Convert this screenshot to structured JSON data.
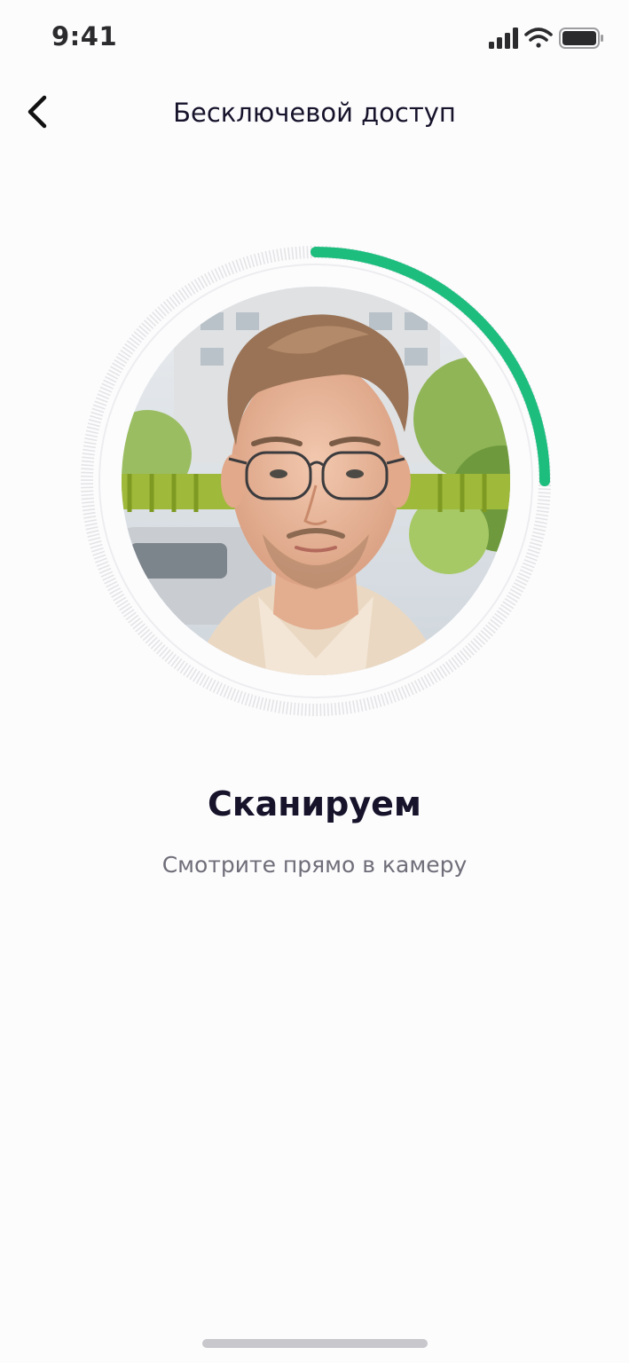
{
  "status_bar": {
    "time": "9:41",
    "icons": [
      "cellular-signal-icon",
      "wifi-icon",
      "battery-icon"
    ]
  },
  "nav": {
    "back_icon": "chevron-left-icon",
    "title": "Бесключевой доступ"
  },
  "scanner": {
    "progress": 0.25,
    "progress_color": "#1dbd7e",
    "track_color": "#e4e4e7",
    "photo": "face-camera-preview"
  },
  "scan_status": {
    "title": "Сканируем",
    "subtitle": "Смотрите прямо в камеру"
  }
}
